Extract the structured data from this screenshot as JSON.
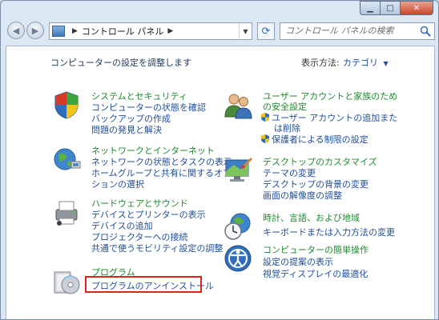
{
  "address": {
    "path": "コントロール パネル"
  },
  "search": {
    "placeholder": "コントロール パネルの検索"
  },
  "header": {
    "intro": "コンピューターの設定を調整します",
    "view_by_label": "表示方法:",
    "view_by_value": "カテゴリ"
  },
  "categories": {
    "system": {
      "title": "システムとセキュリティ",
      "links": [
        "コンピューターの状態を確認",
        "バックアップの作成",
        "問題の発見と解決"
      ]
    },
    "network": {
      "title": "ネットワークとインターネット",
      "links": [
        "ネットワークの状態とタスクの表示",
        "ホームグループと共有に関するオプ",
        "ションの選択"
      ]
    },
    "hardware": {
      "title": "ハードウェアとサウンド",
      "links": [
        "デバイスとプリンターの表示",
        "デバイスの追加",
        "プロジェクターへの接続",
        "共通で使うモビリティ設定の調整"
      ]
    },
    "programs": {
      "title": "プログラム",
      "links": [
        "プログラムのアンインストール"
      ]
    },
    "users": {
      "title_line1": "ユーザー アカウントと家族のため",
      "title_line2": "の安全設定",
      "links": [
        "ユーザー アカウントの追加また",
        "は削除",
        "保護者による制限の設定"
      ]
    },
    "appearance": {
      "title": "デスクトップのカスタマイズ",
      "links": [
        "テーマの変更",
        "デスクトップの背景の変更",
        "画面の解像度の調整"
      ]
    },
    "clock": {
      "title": "時計、言語、および地域",
      "links": [
        "キーボードまたは入力方法の変更"
      ]
    },
    "ease": {
      "title": "コンピューターの簡単操作",
      "links": [
        "設定の提案の表示",
        "視覚ディスプレイの最適化"
      ]
    }
  },
  "colors": {
    "category_title": "#1f8a2f",
    "link": "#1f4e9b",
    "highlight": "#e2231a"
  }
}
